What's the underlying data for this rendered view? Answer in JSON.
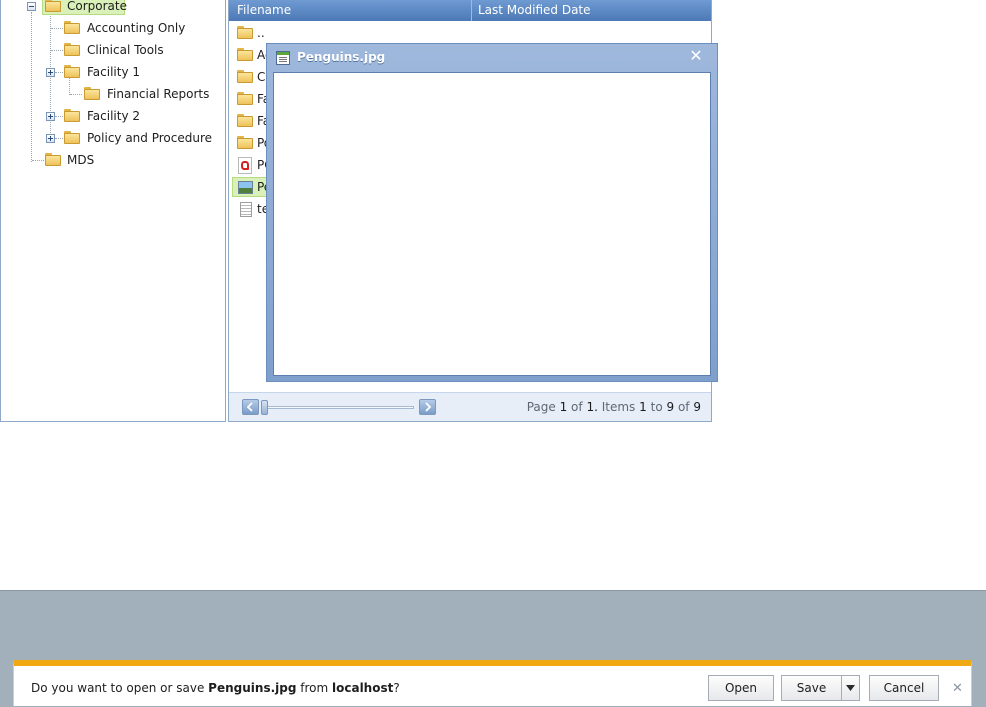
{
  "tree": {
    "nodes": [
      {
        "label": "Corporate",
        "icon": "folder",
        "expander": "minus",
        "selected": true
      },
      {
        "label": "Accounting Only",
        "icon": "folder",
        "expander": "none"
      },
      {
        "label": "Clinical Tools",
        "icon": "folder",
        "expander": "none"
      },
      {
        "label": "Facility 1",
        "icon": "folder",
        "expander": "plus"
      },
      {
        "label": "Financial Reports",
        "icon": "folder",
        "expander": "none"
      },
      {
        "label": "Facility 2",
        "icon": "folder",
        "expander": "plus"
      },
      {
        "label": "Policy and Procedure",
        "icon": "folder",
        "expander": "plus"
      },
      {
        "label": "MDS",
        "icon": "folder",
        "expander": "none"
      }
    ]
  },
  "grid": {
    "columns": [
      "Filename",
      "Last Modified Date"
    ],
    "rows": [
      {
        "label": "..",
        "icon": "folder"
      },
      {
        "label": "Ac",
        "icon": "folder"
      },
      {
        "label": "Cl",
        "icon": "folder"
      },
      {
        "label": "Fa",
        "icon": "folder"
      },
      {
        "label": "Fa",
        "icon": "folder"
      },
      {
        "label": "Po",
        "icon": "folder"
      },
      {
        "label": "PC",
        "icon": "pdf"
      },
      {
        "label": "Pe",
        "icon": "image",
        "selected": true
      },
      {
        "label": "te",
        "icon": "text"
      }
    ],
    "pager": {
      "page_label": "Page",
      "page": "1",
      "of_label": "of",
      "page_count": "1.",
      "items_label": "Items",
      "from": "1",
      "to_label": "to",
      "to": "9",
      "of2_label": "of",
      "total": "9"
    }
  },
  "popup": {
    "title": "Penguins.jpg",
    "close_glyph": "✕"
  },
  "notification": {
    "prefix": "Do you want to open or save ",
    "filename": "Penguins.jpg",
    "middle": " from ",
    "host": "localhost",
    "suffix": "?",
    "open_label": "Open",
    "save_label": "Save",
    "cancel_label": "Cancel",
    "close_glyph": "✕",
    "accent_color": "#f0a913"
  },
  "colors": {
    "header": "#4c79b6",
    "selection": "#d9f0b8"
  }
}
